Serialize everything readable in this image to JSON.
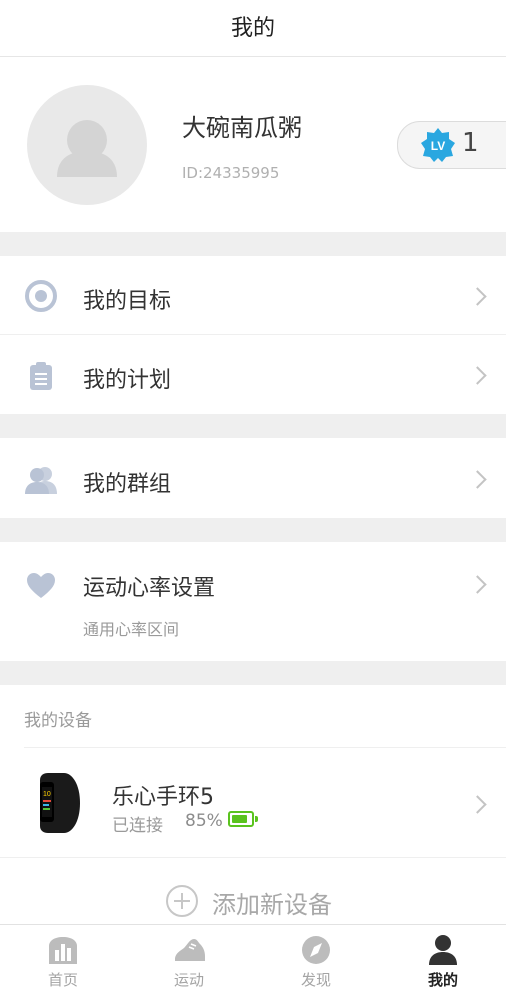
{
  "header": {
    "title": "我的"
  },
  "profile": {
    "name": "大碗南瓜粥",
    "id_text": "ID:24335995",
    "level_badge": "LV",
    "level": "1"
  },
  "menu": [
    {
      "label": "我的目标",
      "icon": "target-icon"
    },
    {
      "label": "我的计划",
      "icon": "clipboard-icon"
    },
    {
      "label": "我的群组",
      "icon": "group-icon"
    },
    {
      "label": "运动心率设置",
      "sub": "通用心率区间",
      "icon": "heart-icon"
    }
  ],
  "devices": {
    "title": "我的设备",
    "items": [
      {
        "name": "乐心手环5",
        "status": "已连接",
        "battery": "85%",
        "battery_level": 0.85
      }
    ],
    "add_label": "添加新设备"
  },
  "tabs": [
    {
      "label": "首页",
      "icon": "home-chart-icon"
    },
    {
      "label": "运动",
      "icon": "shoe-icon"
    },
    {
      "label": "发现",
      "icon": "compass-icon"
    },
    {
      "label": "我的",
      "icon": "person-icon",
      "active": true
    }
  ],
  "colors": {
    "separator": "#efefef",
    "icon_gray": "#b9c3d5",
    "lv_blue": "#2aa7e0",
    "battery_green": "#5ac31e"
  }
}
